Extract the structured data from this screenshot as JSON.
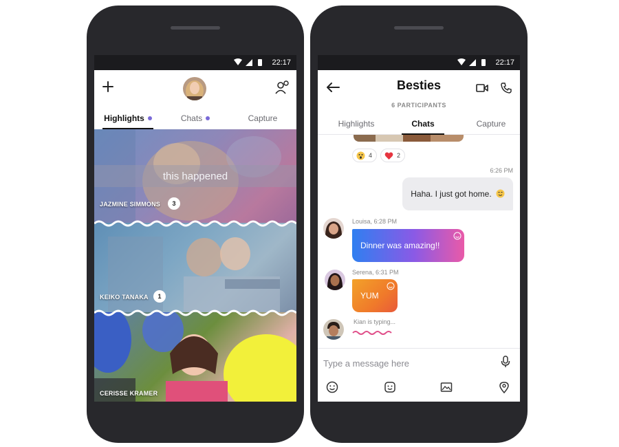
{
  "status_bar": {
    "time": "22:17"
  },
  "highlights_screen": {
    "tabs": [
      {
        "label": "Highlights",
        "active": true,
        "dot": true
      },
      {
        "label": "Chats",
        "active": false,
        "dot": true
      },
      {
        "label": "Capture",
        "active": false,
        "dot": false
      }
    ],
    "cards": [
      {
        "name": "JAZMINE SIMMONS",
        "count": "3",
        "caption": "this happened"
      },
      {
        "name": "KEIKO TANAKA",
        "count": "1"
      },
      {
        "name": "CERISSE KRAMER"
      }
    ]
  },
  "chat_screen": {
    "title": "Besties",
    "subtitle": "6 PARTICIPANTS",
    "tabs": [
      {
        "label": "Highlights",
        "active": false
      },
      {
        "label": "Chats",
        "active": true
      },
      {
        "label": "Capture",
        "active": false
      }
    ],
    "reactions": [
      {
        "icon": "surprised-face-icon",
        "count": "4"
      },
      {
        "icon": "heart-icon",
        "count": "2"
      }
    ],
    "messages": [
      {
        "time": "6:26 PM",
        "text": "Haha. I just got home."
      },
      {
        "sender": "Louisa, 6:28 PM",
        "text": "Dinner was amazing!!"
      },
      {
        "sender": "Serena, 6:31 PM",
        "text": "YUM"
      }
    ],
    "typing": "Kian is typing...",
    "input": {
      "placeholder": "Type a message here",
      "value": ""
    }
  },
  "colors": {
    "accent_purple": "#7a6ad8",
    "dark_frame": "#28282c",
    "bubble_grey": "#ececef"
  }
}
